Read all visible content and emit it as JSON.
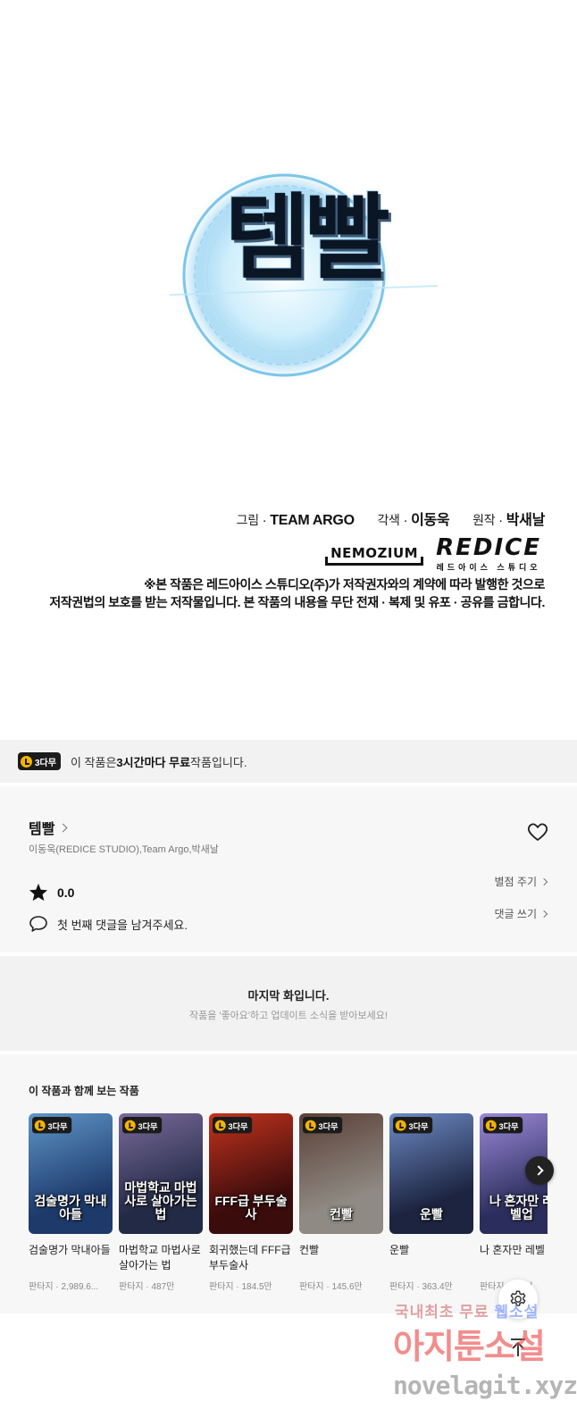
{
  "hero": {
    "logo_text": "템빨",
    "credits": {
      "art_label": "그림",
      "art_value": "TEAM ARGO",
      "adapt_label": "각색",
      "adapt_value": "이동욱",
      "orig_label": "원작",
      "orig_value": "박새날",
      "sep": "·"
    },
    "brand_left": "NEMOZIUM",
    "brand_right_main": "REDICE",
    "brand_right_sub": "레드아이스 스튜디오",
    "notice_line1": "※본 작품은 레드아이스 스튜디오(주)가 저작권자와의 계약에 따라 발행한 것으로",
    "notice_line2": "저작권법의 보호를 받는 저작물입니다. 본 작품의 내용을 무단 전재 · 복제 및 유포 · 공유를 금합니다."
  },
  "free_bar": {
    "badge": "3다무",
    "text_before": "이 작품은 ",
    "text_bold": "3시간마다 무료",
    "text_after": " 작품입니다."
  },
  "info": {
    "title": "템빨",
    "authors": "이동욱(REDICE STUDIO),Team Argo,박새날",
    "rating": "0.0",
    "rate_link": "별점 주기",
    "comment_prompt": "첫 번째 댓글을 남겨주세요.",
    "comment_link": "댓글 쓰기",
    "icons": {
      "like": "heart-icon",
      "star": "star-icon",
      "comment": "comment-icon"
    }
  },
  "last": {
    "title": "마지막 화입니다.",
    "subtitle": "작품을 '좋아요'하고 업데이트 소식을 받아보세요!"
  },
  "recs": {
    "heading": "이 작품과 함께 보는 작품",
    "items": [
      {
        "badge": "3다무",
        "art_title": "검술명가 막내아들",
        "name": "검술명가 막내아들",
        "meta": "판타지 · 2,989.6...",
        "color1": "#1d3a6b",
        "color2": "#5f95c8"
      },
      {
        "badge": "3다무",
        "art_title": "마법학교 마법사로 살아가는 법",
        "name": "마법학교 마법사로 살아가는 법",
        "meta": "판타지 · 487만",
        "color1": "#222a45",
        "color2": "#7a6a9a"
      },
      {
        "badge": "3다무",
        "art_title": "FFF급 부두술사",
        "name": "회귀했는데 FFF급 부두술사",
        "meta": "판타지 · 184.5만",
        "color1": "#3a0c0c",
        "color2": "#c2331d"
      },
      {
        "badge": "3다무",
        "art_title": "컨빨",
        "name": "컨빨",
        "meta": "판타지 · 145.6만",
        "color1": "#8f8a83",
        "color2": "#5a4037"
      },
      {
        "badge": "3다무",
        "art_title": "운빨",
        "name": "운빨",
        "meta": "판타지 · 363.4만",
        "color1": "#1c2440",
        "color2": "#6d8ac4"
      },
      {
        "badge": "3다무",
        "art_title": "나 혼자만 레벨업",
        "name": "나 혼자만 레벨",
        "meta": "판타지 · 3.9억",
        "color1": "#2b2e5c",
        "color2": "#9b88d8"
      }
    ]
  },
  "floating": {
    "settings_icon": "gear-icon",
    "top_icon": "arrow-up-icon"
  },
  "watermark": {
    "line1": "국내최초 무료",
    "line1_hl": "웹소설",
    "line2": "아지툰소설",
    "line3": "novelagit.xyz"
  }
}
